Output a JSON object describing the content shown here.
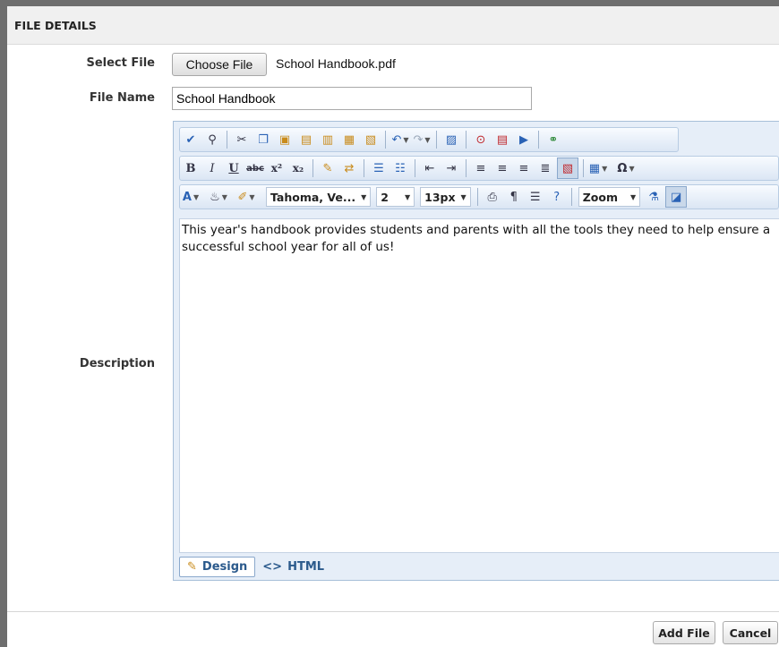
{
  "panel": {
    "title": "FILE DETAILS"
  },
  "fields": {
    "select_file": {
      "label": "Select File",
      "button": "Choose File",
      "chosen": "School Handbook.pdf"
    },
    "file_name": {
      "label": "File Name",
      "value": "School Handbook"
    },
    "description": {
      "label": "Description"
    }
  },
  "editor": {
    "font_name": "Tahoma, Ve...",
    "font_size": "2",
    "font_px": "13px",
    "zoom": "Zoom",
    "content": "This year's handbook provides students and parents with all the tools they need to help ensure a successful school year for all of us!",
    "modes": {
      "design": "Design",
      "html": "HTML"
    },
    "glyphs": {
      "bold": "B",
      "italic": "I",
      "underline": "U",
      "strike": "abc",
      "superscript": "x²",
      "subscript": "x₂",
      "font_color": "A",
      "omega": "Ω"
    }
  },
  "buttons": {
    "add": "Add File",
    "cancel": "Cancel"
  }
}
